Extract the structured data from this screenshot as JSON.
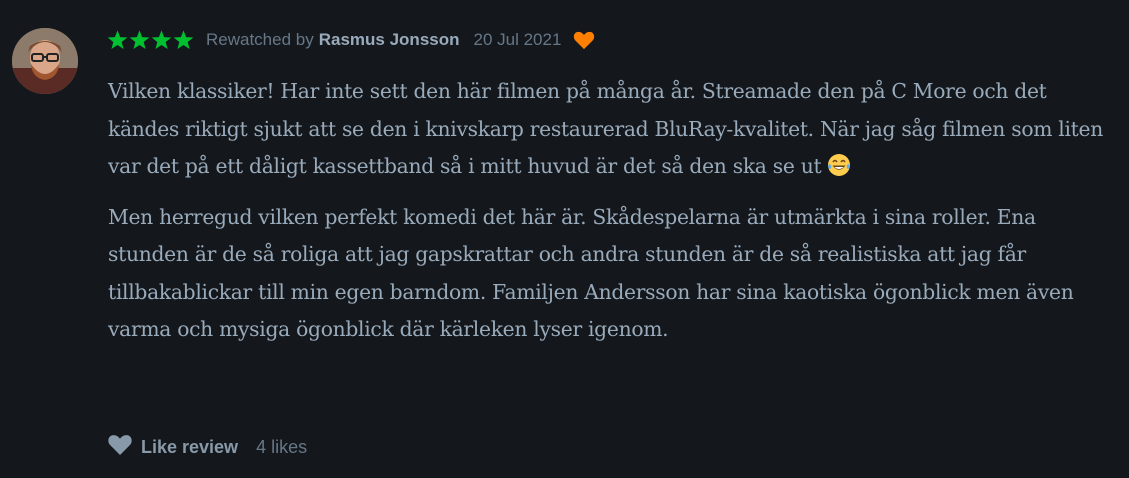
{
  "review": {
    "rating_stars": 4,
    "star_color": "#00c030",
    "action_text": "Rewatched by",
    "reviewer": "Rasmus Jonsson",
    "date": "20 Jul 2021",
    "liked_icon": "heart-icon",
    "liked_color": "#ff8000",
    "paragraphs": [
      "Vilken klassiker! Har inte sett den här filmen på många år. Streamade den på C More och det kändes riktigt sjukt att se den i knivskarp restaurerad BluRay-kvalitet. När jag såg filmen som liten var det på ett dåligt kassettband så i mitt huvud är det så den ska se ut",
      "Men herregud vilken perfekt komedi det här är. Skådespelarna är utmärkta i sina roller. Ena stunden är de så roliga att jag gapskrattar och andra stunden är de så realistiska att jag får tillbakablickar till min egen barndom. Familjen Andersson har sina kaotiska ögonblick men även varma och mysiga ögonblick där kärleken lyser igenom."
    ],
    "emoji_icon": "laughing-tears-emoji-icon",
    "like_label": "Like review",
    "likes_count": "4 likes"
  }
}
